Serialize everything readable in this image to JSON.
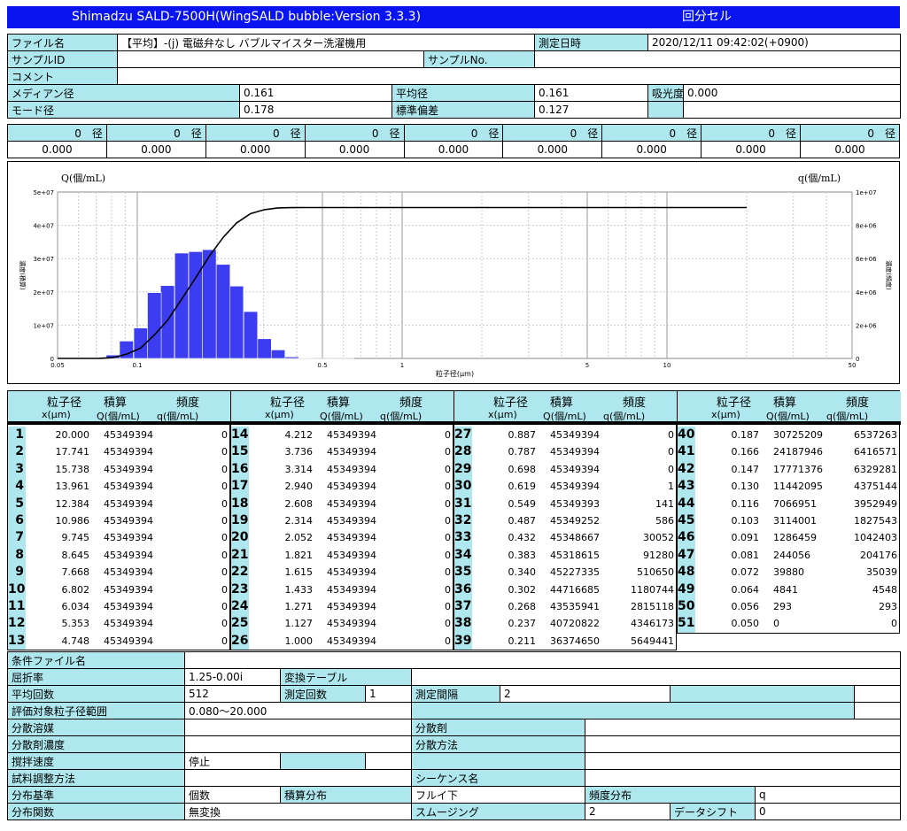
{
  "header": {
    "title": "Shimadzu SALD-7500H(WingSALD bubble:Version 3.3.3)",
    "mode": "回分セル"
  },
  "info": {
    "file_label": "ファイル名",
    "file_value": "【平均】-(j) 電磁弁なし バブルマイスター洗濯機用",
    "date_label": "測定日時",
    "date_value": "2020/12/11 09:42:02(+0900)",
    "sample_id_label": "サンプルID",
    "sample_no_label": "サンプルNo.",
    "comment_label": "コメント",
    "median_label": "メディアン径",
    "median_value": "0.161",
    "mean_label": "平均径",
    "mean_value": "0.161",
    "absorb_label": "吸光度",
    "absorb_value": "0.000",
    "mode_label": "モード径",
    "mode_value": "0.178",
    "sd_label": "標準偏差",
    "sd_value": "0.127"
  },
  "diam_row": {
    "label": "0　径",
    "values": [
      "0.000",
      "0.000",
      "0.000",
      "0.000",
      "0.000",
      "0.000",
      "0.000",
      "0.000",
      "0.000"
    ]
  },
  "chart_data": {
    "type": "bar",
    "left_axis_label": "Q(個/mL)",
    "right_axis_label": "q(個/mL)",
    "left_ylabel": "濃度(積算)",
    "right_ylabel": "濃度(頻度)",
    "xlabel": "粒子径(μm)",
    "x_scale": "log",
    "xlim": [
      0.05,
      50
    ],
    "x_ticks": [
      "0.05",
      "0.1",
      "0.5",
      "1",
      "5",
      "10",
      "50"
    ],
    "left_ticks": [
      "0",
      "1e+07",
      "2e+07",
      "3e+07",
      "4e+07",
      "5e+07"
    ],
    "right_ticks": [
      "0",
      "2e+06",
      "4e+06",
      "6e+06",
      "8e+06",
      "1e+07"
    ],
    "left_ylim": [
      0,
      50000000
    ],
    "right_ylim": [
      0,
      10000000
    ],
    "bar_color": "#3c3cf0",
    "line_color": "#000000"
  },
  "table": {
    "col_headers": [
      "粒子径",
      "積算",
      "頻度"
    ],
    "col_units": [
      "x(μm)",
      "Q(個/mL)",
      "q(個/mL)"
    ],
    "rows": [
      [
        "1",
        "20.000",
        "45349394",
        "0"
      ],
      [
        "2",
        "17.741",
        "45349394",
        "0"
      ],
      [
        "3",
        "15.738",
        "45349394",
        "0"
      ],
      [
        "4",
        "13.961",
        "45349394",
        "0"
      ],
      [
        "5",
        "12.384",
        "45349394",
        "0"
      ],
      [
        "6",
        "10.986",
        "45349394",
        "0"
      ],
      [
        "7",
        "9.745",
        "45349394",
        "0"
      ],
      [
        "8",
        "8.645",
        "45349394",
        "0"
      ],
      [
        "9",
        "7.668",
        "45349394",
        "0"
      ],
      [
        "10",
        "6.802",
        "45349394",
        "0"
      ],
      [
        "11",
        "6.034",
        "45349394",
        "0"
      ],
      [
        "12",
        "5.353",
        "45349394",
        "0"
      ],
      [
        "13",
        "4.748",
        "45349394",
        "0"
      ],
      [
        "14",
        "4.212",
        "45349394",
        "0"
      ],
      [
        "15",
        "3.736",
        "45349394",
        "0"
      ],
      [
        "16",
        "3.314",
        "45349394",
        "0"
      ],
      [
        "17",
        "2.940",
        "45349394",
        "0"
      ],
      [
        "18",
        "2.608",
        "45349394",
        "0"
      ],
      [
        "19",
        "2.314",
        "45349394",
        "0"
      ],
      [
        "20",
        "2.052",
        "45349394",
        "0"
      ],
      [
        "21",
        "1.821",
        "45349394",
        "0"
      ],
      [
        "22",
        "1.615",
        "45349394",
        "0"
      ],
      [
        "23",
        "1.433",
        "45349394",
        "0"
      ],
      [
        "24",
        "1.271",
        "45349394",
        "0"
      ],
      [
        "25",
        "1.127",
        "45349394",
        "0"
      ],
      [
        "26",
        "1.000",
        "45349394",
        "0"
      ],
      [
        "27",
        "0.887",
        "45349394",
        "0"
      ],
      [
        "28",
        "0.787",
        "45349394",
        "0"
      ],
      [
        "29",
        "0.698",
        "45349394",
        "0"
      ],
      [
        "30",
        "0.619",
        "45349394",
        "1"
      ],
      [
        "31",
        "0.549",
        "45349393",
        "141"
      ],
      [
        "32",
        "0.487",
        "45349252",
        "586"
      ],
      [
        "33",
        "0.432",
        "45348667",
        "30052"
      ],
      [
        "34",
        "0.383",
        "45318615",
        "91280"
      ],
      [
        "35",
        "0.340",
        "45227335",
        "510650"
      ],
      [
        "36",
        "0.302",
        "44716685",
        "1180744"
      ],
      [
        "37",
        "0.268",
        "43535941",
        "2815118"
      ],
      [
        "38",
        "0.237",
        "40720822",
        "4346173"
      ],
      [
        "39",
        "0.211",
        "36374650",
        "5649441"
      ],
      [
        "40",
        "0.187",
        "30725209",
        "6537263"
      ],
      [
        "41",
        "0.166",
        "24187946",
        "6416571"
      ],
      [
        "42",
        "0.147",
        "17771376",
        "6329281"
      ],
      [
        "43",
        "0.130",
        "11442095",
        "4375144"
      ],
      [
        "44",
        "0.116",
        "7066951",
        "3952949"
      ],
      [
        "45",
        "0.103",
        "3114001",
        "1827543"
      ],
      [
        "46",
        "0.091",
        "1286459",
        "1042403"
      ],
      [
        "47",
        "0.081",
        "244056",
        "204176"
      ],
      [
        "48",
        "0.072",
        "39880",
        "35039"
      ],
      [
        "49",
        "0.064",
        "4841",
        "4548"
      ],
      [
        "50",
        "0.056",
        "293",
        "293"
      ],
      [
        "51",
        "0.050",
        "0",
        "0"
      ]
    ]
  },
  "conditions": {
    "cond_file": "条件ファイル名",
    "refr": "屈折率",
    "refr_value": "1.25-0.00i",
    "conv_table": "変換テーブル",
    "avg_count": "平均回数",
    "avg_value": "512",
    "meas_count": "測定回数",
    "meas_value": "1",
    "meas_interval": "測定間隔",
    "interval_value": "2",
    "range": "評価対象粒子径範囲",
    "range_value": "0.080～20.000",
    "solvent": "分散溶媒",
    "dispersant": "分散剤",
    "disp_conc": "分散剤濃度",
    "disp_method": "分散方法",
    "stir": "撹拌速度",
    "stir_value": "停止",
    "prep": "試料調整方法",
    "sequence": "シーケンス名",
    "dist_base": "分布基準",
    "dist_base_value": "個数",
    "cum_dist": "積算分布",
    "cum_value": "フルイ下",
    "freq_dist": "頻度分布",
    "freq_value": "q",
    "dist_func": "分布関数",
    "dist_func_value": "無変換",
    "smoothing": "スムージング",
    "smooth_value": "2",
    "data_shift": "データシフト",
    "shift_value": "0"
  }
}
